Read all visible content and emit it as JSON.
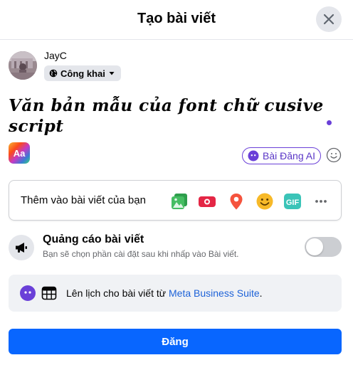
{
  "dialog": {
    "title": "Tạo bài viết"
  },
  "user": {
    "name": "JayC",
    "privacy_label": "Công khai"
  },
  "composer": {
    "text": "Văn bản mẫu của font chữ cusive script",
    "text_bg_button_label": "Aa",
    "ai_button_label": "Bài Đăng AI"
  },
  "add_to_post": {
    "label": "Thêm vào bài viết của bạn",
    "icons": [
      "photo-video-icon",
      "live-video-icon",
      "location-pin-icon",
      "feeling-icon",
      "gif-icon",
      "more-icon"
    ],
    "gif_label": "GIF"
  },
  "ads": {
    "title": "Quảng cáo bài viết",
    "subtitle": "Bạn sẽ chọn phần cài đặt sau khi nhấp vào Bài viết.",
    "toggle_on": false
  },
  "schedule": {
    "text": "Lên lịch cho bài viết từ ",
    "link": "Meta Business Suite",
    "suffix": "."
  },
  "actions": {
    "post_label": "Đăng"
  },
  "colors": {
    "primary": "#0866ff",
    "ai_purple": "#6a40d8",
    "link": "#1d62d8",
    "photo": "#45bd62",
    "live": "#e42645",
    "location": "#f5533d",
    "feeling": "#f7b928",
    "gif": "#3bc4b8"
  }
}
